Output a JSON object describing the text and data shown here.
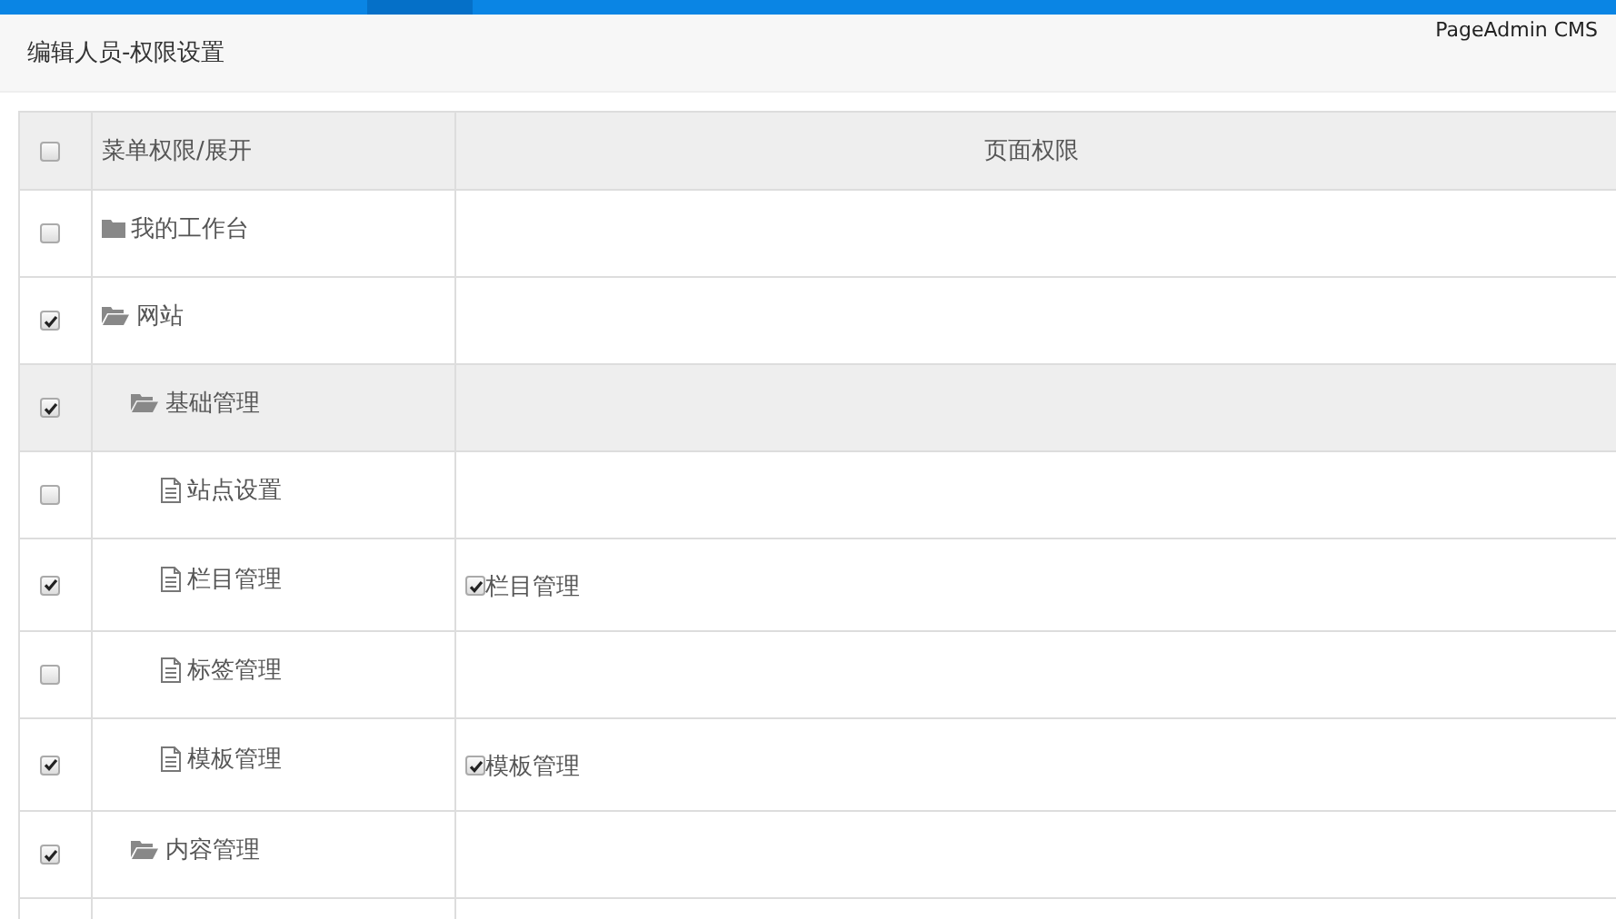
{
  "brand": "PageAdmin CMS",
  "page_title": "编辑人员-权限设置",
  "table": {
    "select_all": {
      "checked": false
    },
    "columns": [
      "菜单权限/展开",
      "页面权限"
    ],
    "rows": [
      {
        "label": "我的工作台",
        "kind": "folder",
        "expanded": false,
        "checked": false,
        "highlighted": false
      },
      {
        "label": "网站",
        "kind": "folder",
        "expanded": true,
        "checked": true,
        "highlighted": false,
        "children": [
          {
            "label": "基础管理",
            "kind": "folder",
            "expanded": true,
            "checked": true,
            "highlighted": true,
            "children": [
              {
                "label": "站点设置",
                "kind": "page",
                "checked": false,
                "highlighted": false
              },
              {
                "label": "栏目管理",
                "kind": "page",
                "checked": true,
                "highlighted": false,
                "page_permissions": [
                  {
                    "label": "栏目管理",
                    "checked": true
                  }
                ]
              },
              {
                "label": "标签管理",
                "kind": "page",
                "checked": false,
                "highlighted": false
              },
              {
                "label": "模板管理",
                "kind": "page",
                "checked": true,
                "highlighted": false,
                "page_permissions": [
                  {
                    "label": "模板管理",
                    "checked": true
                  }
                ]
              }
            ]
          },
          {
            "label": "内容管理",
            "kind": "folder",
            "expanded": true,
            "checked": true,
            "highlighted": false
          }
        ]
      }
    ]
  }
}
